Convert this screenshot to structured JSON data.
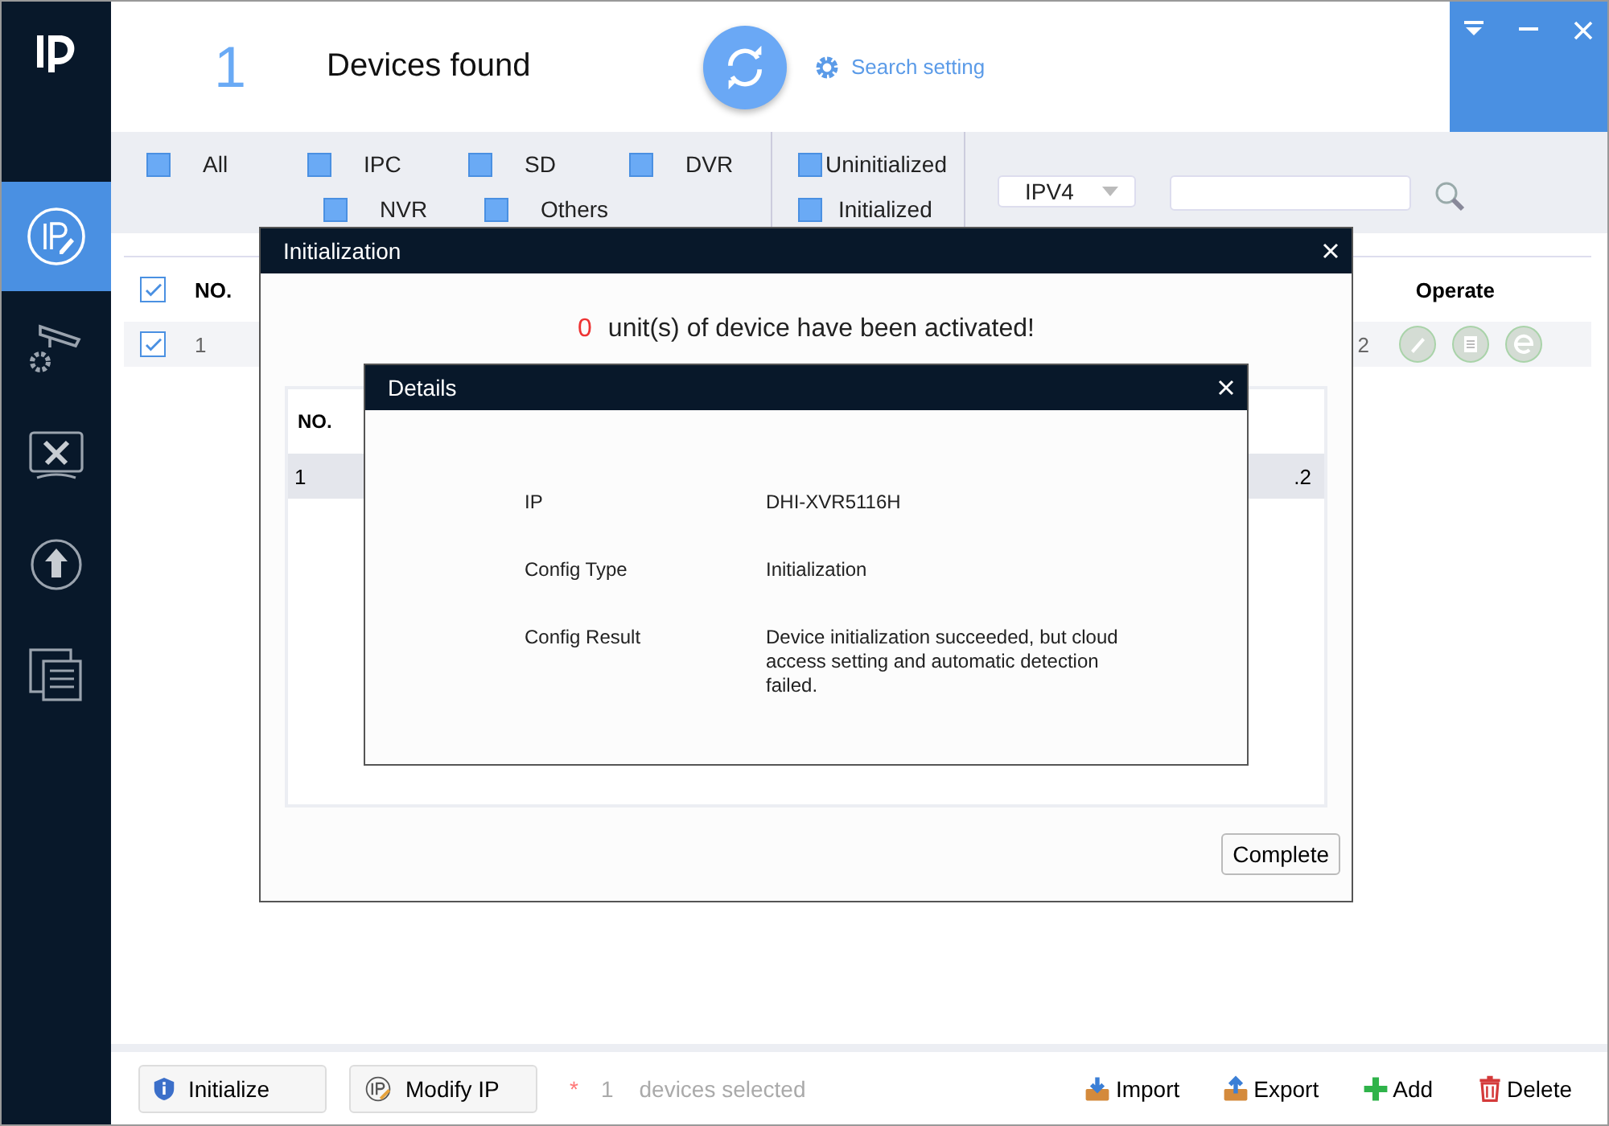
{
  "header": {
    "count": "1",
    "title": "Devices found",
    "search_setting": "Search setting"
  },
  "sidebar": {
    "items": [
      {
        "kind": "ip",
        "selected": true
      },
      {
        "kind": "camera",
        "selected": false
      },
      {
        "kind": "tools",
        "selected": false
      },
      {
        "kind": "upgrade",
        "selected": false
      },
      {
        "kind": "docs",
        "selected": false
      }
    ]
  },
  "filters": {
    "types": [
      {
        "label": "All",
        "checked": false
      },
      {
        "label": "IPC",
        "checked": false
      },
      {
        "label": "SD",
        "checked": false
      },
      {
        "label": "DVR",
        "checked": false
      },
      {
        "label": "NVR",
        "checked": false
      },
      {
        "label": "Others",
        "checked": false
      }
    ],
    "status": [
      {
        "label": "Uninitialized",
        "checked": false
      },
      {
        "label": "Initialized",
        "checked": false
      }
    ],
    "protocol": "IPV4"
  },
  "table": {
    "all_checked": true,
    "columns": [
      "NO.",
      "Operate"
    ],
    "rows": [
      {
        "checked": true,
        "no": "1",
        "column_3": "2"
      }
    ]
  },
  "init_dialog": {
    "title": "Initialization",
    "count": "0",
    "message": "unit(s) of device have been activated!",
    "columns": [
      "NO."
    ],
    "rows": [
      {
        "no": "1",
        "column_2": ".2"
      }
    ],
    "button": "Complete"
  },
  "details_dialog": {
    "title": "Details",
    "fields": [
      {
        "label": "IP",
        "value": "DHI-XVR5116H"
      },
      {
        "label": "Config Type",
        "value": "Initialization"
      },
      {
        "label": "Config Result",
        "value": "Device initialization succeeded, but cloud access setting and automatic detection failed."
      }
    ]
  },
  "footer": {
    "initialize": "Initialize",
    "modify_ip": "Modify IP",
    "asterisk": "*",
    "selected_count": "1",
    "selected_text": "devices selected",
    "actions": [
      {
        "kind": "import",
        "label": "Import"
      },
      {
        "kind": "export",
        "label": "Export"
      },
      {
        "kind": "add",
        "label": "Add"
      },
      {
        "kind": "delete",
        "label": "Delete"
      }
    ]
  }
}
